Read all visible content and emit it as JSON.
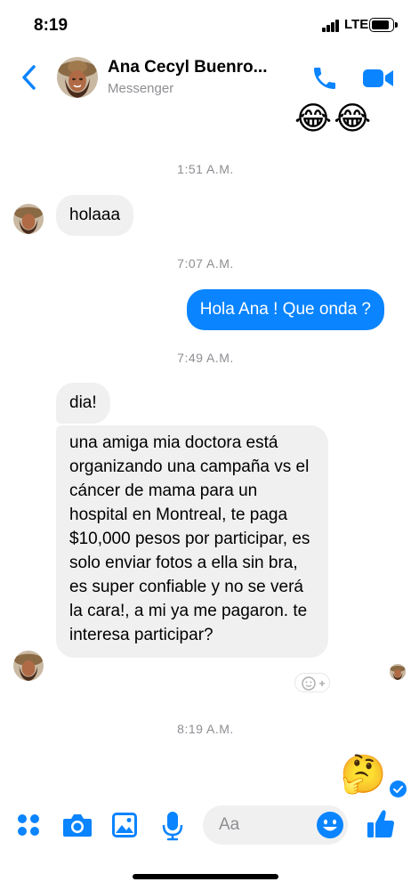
{
  "status_bar": {
    "time": "8:19",
    "network": "LTE"
  },
  "header": {
    "contact_name": "Ana Cecyl Buenro...",
    "subtitle": "Messenger"
  },
  "conversation": {
    "emoji_top": "😂😂",
    "timestamps": [
      "1:51 A.M.",
      "7:07 A.M.",
      "7:49 A.M.",
      "8:19 A.M."
    ],
    "messages": [
      {
        "from": "contact",
        "text": "holaaa"
      },
      {
        "from": "me",
        "text": "Hola Ana ! Que onda ?"
      },
      {
        "from": "contact",
        "text": "dia!"
      },
      {
        "from": "contact",
        "text": "una amiga mia doctora está organizando una campaña vs el cáncer de mama para un hospital en Montreal, te paga $10,000 pesos por participar, es solo enviar fotos a ella sin bra, es super confiable y no se verá la cara!, a mi ya me pagaron. te interesa participar?"
      },
      {
        "from": "me",
        "text": "🤔"
      }
    ]
  },
  "composer": {
    "placeholder": "Aa"
  },
  "colors": {
    "accent": "#0a84ff",
    "received_bubble": "#f0f0f0",
    "timestamp": "#8e8e93"
  },
  "icons": [
    "back-chevron-icon",
    "phone-icon",
    "video-icon",
    "apps-grid-icon",
    "camera-icon",
    "gallery-icon",
    "microphone-icon",
    "emoji-icon",
    "thumbs-up-icon",
    "add-reaction-icon",
    "delivered-check-icon"
  ]
}
